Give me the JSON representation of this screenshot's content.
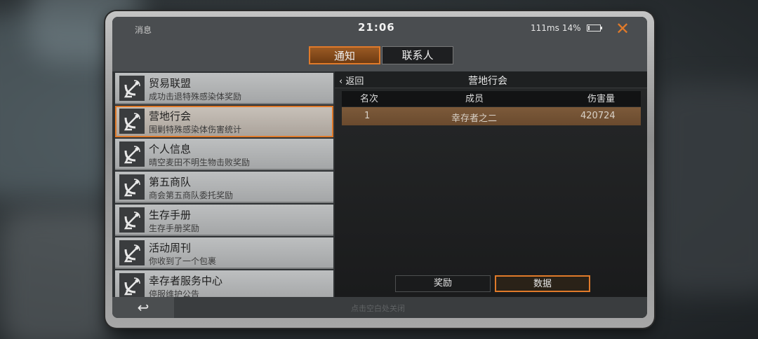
{
  "statusbar": {
    "messages_label": "消息",
    "time": "21:06",
    "latency": "111ms",
    "battery_pct": "14%",
    "battery_fraction": 0.14,
    "close_symbol": "✕"
  },
  "tabs": [
    {
      "label": "通知",
      "active": true
    },
    {
      "label": "联系人",
      "active": false
    }
  ],
  "list": [
    {
      "title": "贸易联盟",
      "subtitle": "成功击退特殊感染体奖励",
      "icon": "satellite-dish-icon"
    },
    {
      "title": "营地行会",
      "subtitle": "围剿特殊感染体伤害统计",
      "icon": "satellite-dish-icon",
      "selected": true
    },
    {
      "title": "个人信息",
      "subtitle": "晴空麦田不明生物击败奖励",
      "icon": "satellite-dish-icon"
    },
    {
      "title": "第五商队",
      "subtitle": "商会第五商队委托奖励",
      "icon": "satellite-dish-icon"
    },
    {
      "title": "生存手册",
      "subtitle": "生存手册奖励",
      "icon": "satellite-dish-icon"
    },
    {
      "title": "活动周刊",
      "subtitle": "你收到了一个包裹",
      "icon": "satellite-dish-icon"
    },
    {
      "title": "幸存者服务中心",
      "subtitle": "停服维护公告",
      "icon": "satellite-dish-icon"
    }
  ],
  "detail": {
    "back_label": "返回",
    "title": "营地行会",
    "columns": [
      "名次",
      "成员",
      "伤害量"
    ],
    "rows": [
      {
        "rank": "1",
        "member": "幸存者之二",
        "damage": "420724"
      }
    ],
    "buttons": {
      "reward": "奖励",
      "data": "数据"
    }
  },
  "footer": {
    "back_symbol": "↩",
    "hint": "点击空白处关闭"
  },
  "colors": {
    "accent": "#e07a2a",
    "panel": "#4a4d50",
    "list_item": "#b3b5b6",
    "row_highlight": "#745236"
  }
}
